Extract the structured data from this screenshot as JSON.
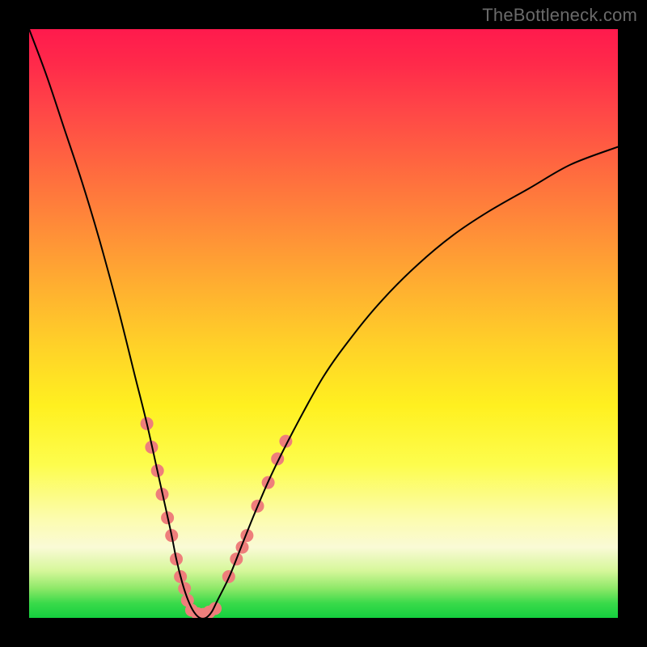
{
  "watermark": {
    "text": "TheBottleneck.com"
  },
  "chart_data": {
    "type": "line",
    "title": "",
    "xlabel": "",
    "ylabel": "",
    "xlim": [
      0,
      100
    ],
    "ylim": [
      0,
      100
    ],
    "grid": false,
    "legend": false,
    "annotations": [],
    "background_gradient": {
      "direction": "vertical",
      "stops": [
        {
          "pos": 0.0,
          "color": "#ff1a4d"
        },
        {
          "pos": 0.24,
          "color": "#ff6a3f"
        },
        {
          "pos": 0.54,
          "color": "#ffd228"
        },
        {
          "pos": 0.83,
          "color": "#fcfcad"
        },
        {
          "pos": 0.95,
          "color": "#8ee868"
        },
        {
          "pos": 1.0,
          "color": "#14cf3e"
        }
      ]
    },
    "series": [
      {
        "name": "bottleneck-curve",
        "color": "#000000",
        "stroke_width": 2,
        "x": [
          0,
          3,
          6,
          9,
          12,
          15,
          18,
          20,
          22,
          24,
          25,
          26,
          27,
          28,
          29,
          30,
          31,
          32,
          34,
          36,
          38,
          41,
          45,
          50,
          55,
          60,
          66,
          72,
          78,
          85,
          92,
          100
        ],
        "y": [
          100,
          92,
          83,
          74,
          64,
          53,
          41,
          33,
          24,
          15,
          10,
          6,
          3,
          1,
          0,
          0,
          1,
          3,
          7,
          12,
          17,
          24,
          32,
          41,
          48,
          54,
          60,
          65,
          69,
          73,
          77,
          80
        ]
      }
    ],
    "markers": [
      {
        "name": "left-arm-dots",
        "shape": "circle",
        "color": "#ee7e7b",
        "radius": 8,
        "points": [
          {
            "x": 20.0,
            "y": 33
          },
          {
            "x": 20.8,
            "y": 29
          },
          {
            "x": 21.8,
            "y": 25
          },
          {
            "x": 22.6,
            "y": 21
          },
          {
            "x": 23.5,
            "y": 17
          },
          {
            "x": 24.2,
            "y": 14
          },
          {
            "x": 25.0,
            "y": 10
          },
          {
            "x": 25.7,
            "y": 7
          },
          {
            "x": 26.4,
            "y": 5
          },
          {
            "x": 26.9,
            "y": 3
          }
        ]
      },
      {
        "name": "valley-dots",
        "shape": "circle",
        "color": "#ee7e7b",
        "radius": 8,
        "points": [
          {
            "x": 27.6,
            "y": 1.3
          },
          {
            "x": 28.6,
            "y": 0.7
          },
          {
            "x": 29.6,
            "y": 0.6
          },
          {
            "x": 30.6,
            "y": 1.0
          },
          {
            "x": 31.6,
            "y": 1.6
          }
        ]
      },
      {
        "name": "right-arm-dots",
        "shape": "circle",
        "color": "#ee7e7b",
        "radius": 8,
        "points": [
          {
            "x": 33.9,
            "y": 7
          },
          {
            "x": 35.2,
            "y": 10
          },
          {
            "x": 36.2,
            "y": 12
          },
          {
            "x": 37.0,
            "y": 14
          },
          {
            "x": 38.8,
            "y": 19
          },
          {
            "x": 40.6,
            "y": 23
          },
          {
            "x": 42.2,
            "y": 27
          },
          {
            "x": 43.6,
            "y": 30
          }
        ]
      }
    ]
  }
}
